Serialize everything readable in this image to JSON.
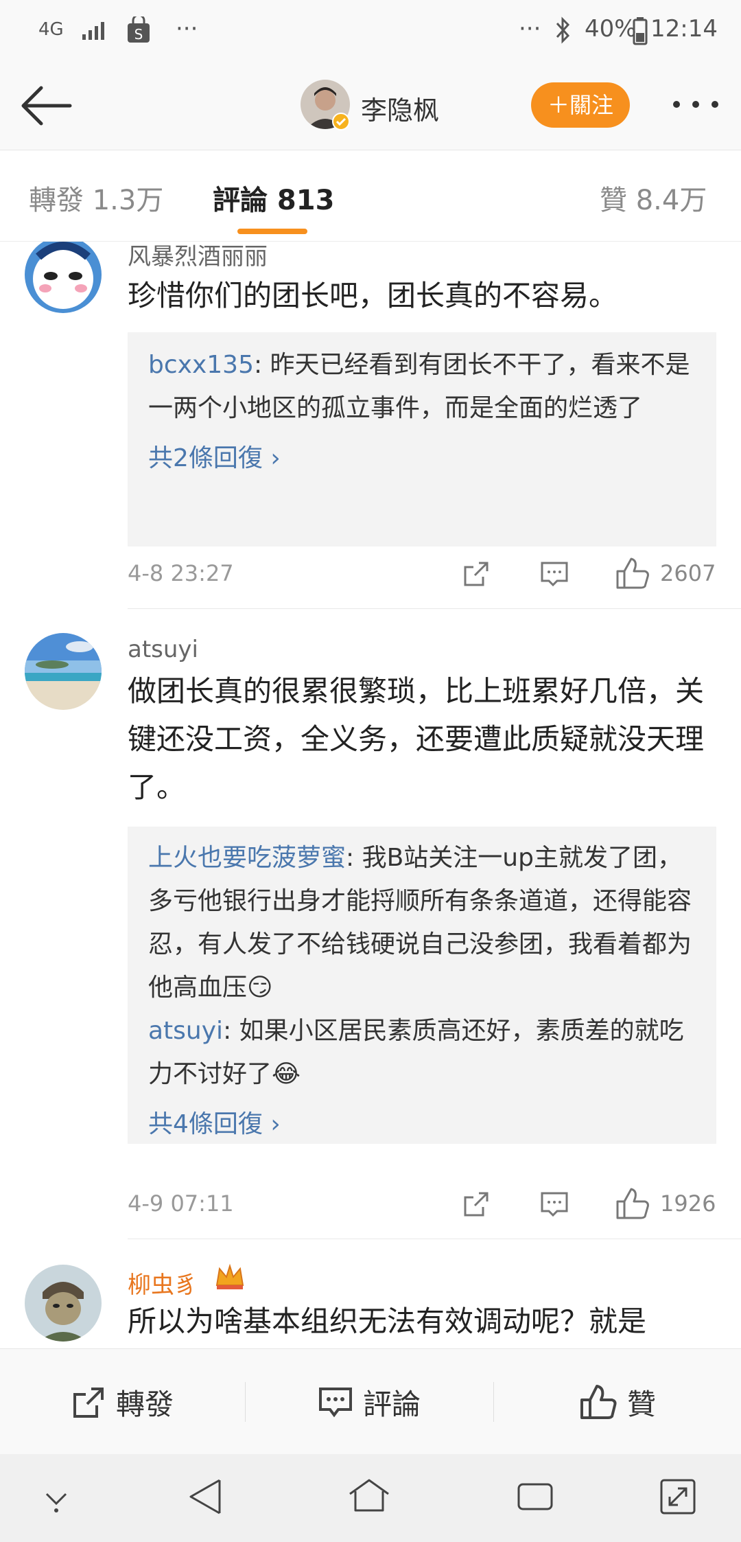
{
  "status_bar": {
    "network": "4G",
    "more_left": "···",
    "more_right": "···",
    "battery": "40%",
    "time": "12:14"
  },
  "header": {
    "title": "李隐枫",
    "follow_label": "＋關注"
  },
  "tabs": {
    "repost": "轉發 1.3万",
    "comments": "評論 813",
    "likes": "贊 8.4万"
  },
  "comments": [
    {
      "username": "风暴烈酒丽丽",
      "text": "珍惜你们的团长吧，团长真的不容易。",
      "replies": [
        {
          "user": "bcxx135",
          "text": ": 昨天已经看到有团长不干了，看来不是一两个小地区的孤立事件，而是全面的烂透了"
        }
      ],
      "more_replies": "共2條回復 ›",
      "time": "4-8 23:27",
      "likes": "2607"
    },
    {
      "username": "atsuyi",
      "text": "做团长真的很累很繁琐，比上班累好几倍，关键还没工资，全义务，还要遭此质疑就没天理了。",
      "replies": [
        {
          "user": "上火也要吃菠萝蜜",
          "text": ": 我B站关注一up主就发了团，多亏他银行出身才能捋顺所有条条道道，还得能容忍，有人发了不给钱硬说自己没参团，我看着都为他高血压😏"
        },
        {
          "user": "atsuyi",
          "text": ": 如果小区居民素质高还好，素质差的就吃力不讨好了😂"
        }
      ],
      "more_replies": "共4條回復 ›",
      "time": "4-9 07:11",
      "likes": "1926"
    },
    {
      "username": "柳虫豸",
      "text": "所以为啥基本组织无法有效调动呢？就是"
    }
  ],
  "bottom_bar": {
    "repost": "轉發",
    "comment": "評論",
    "like": "贊"
  },
  "colors": {
    "accent": "#f7901e",
    "link": "#4a77ad",
    "vip_name": "#e8761e"
  }
}
